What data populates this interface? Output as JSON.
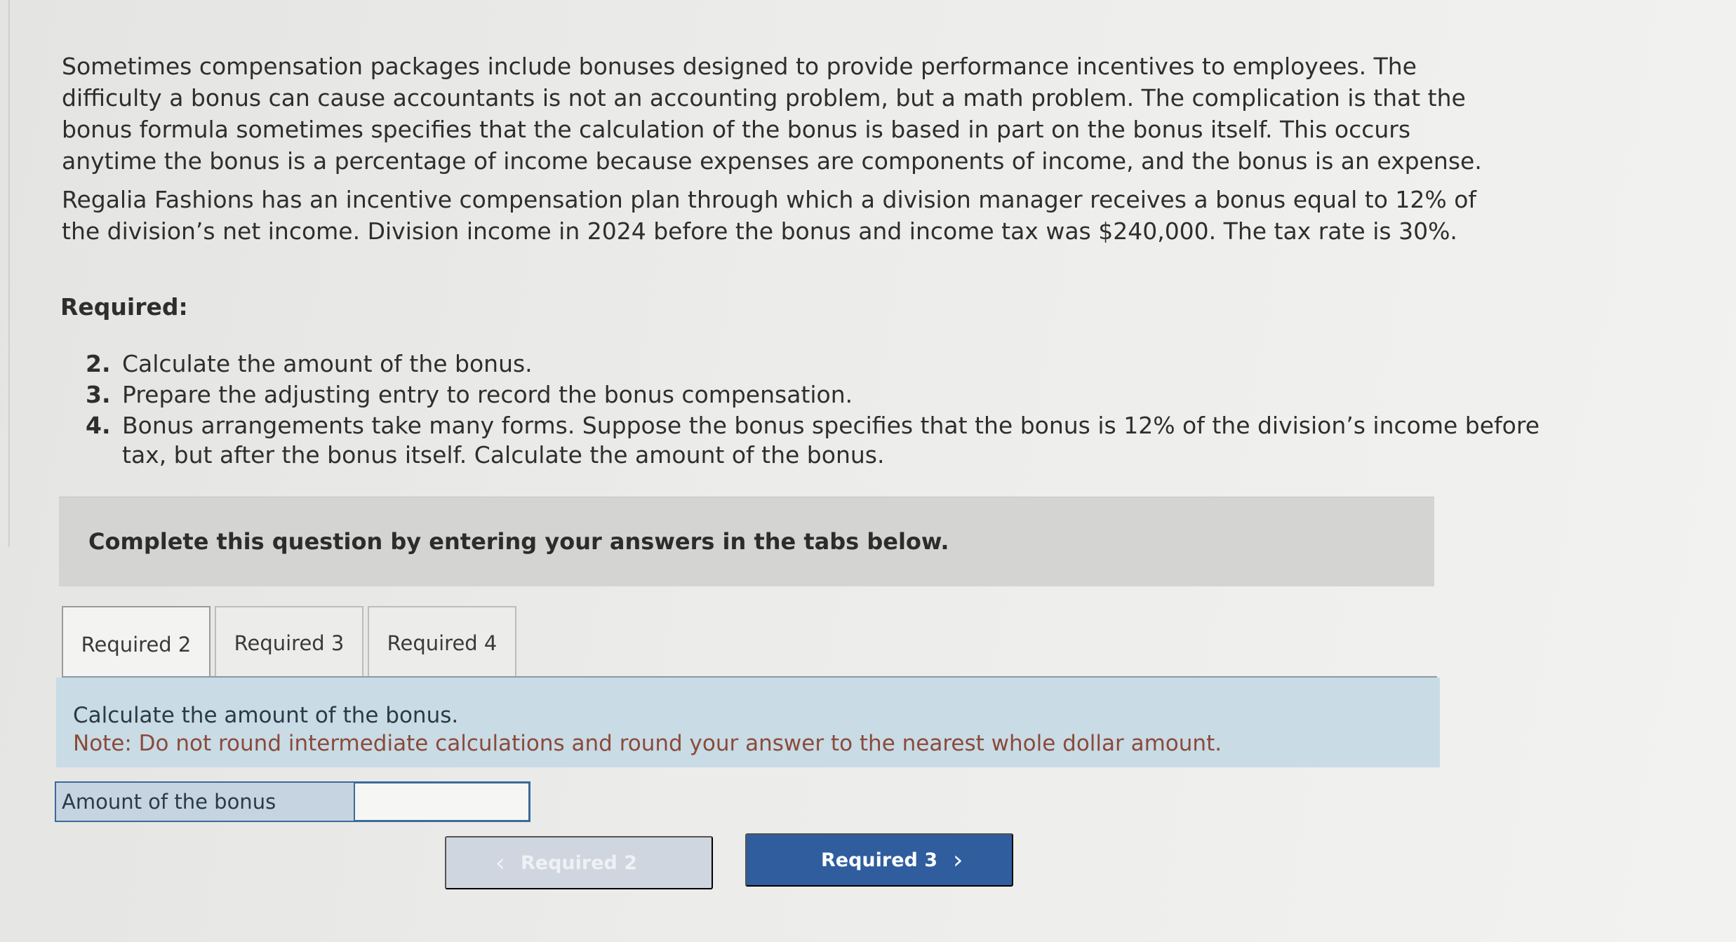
{
  "intro": {
    "paragraph1": "Sometimes compensation packages include bonuses designed to provide performance incentives to employees. The difficulty a bonus can cause accountants is not an accounting problem, but a math problem. The complication is that the bonus formula sometimes specifies that the calculation of the bonus is based in part on the bonus itself. This occurs anytime the bonus is a percentage of income because expenses are components of income, and the bonus is an expense.",
    "paragraph2": "Regalia Fashions has an incentive compensation plan through which a division manager receives a bonus equal to 12% of the division’s net income. Division income in 2024 before the bonus and income tax was $240,000. The tax rate is 30%."
  },
  "required": {
    "heading": "Required:",
    "items": [
      {
        "num": "2.",
        "text": "Calculate the amount of the bonus."
      },
      {
        "num": "3.",
        "text": "Prepare the adjusting entry to record the bonus compensation."
      },
      {
        "num": "4.",
        "text": "Bonus arrangements take many forms. Suppose the bonus specifies that the bonus is 12% of the division’s income before tax, but after the bonus itself. Calculate the amount of the bonus."
      }
    ]
  },
  "banner": {
    "text": "Complete this question by entering your answers in the tabs below."
  },
  "tabs": [
    {
      "label": "Required 2",
      "active": true
    },
    {
      "label": "Required 3",
      "active": false
    },
    {
      "label": "Required 4",
      "active": false
    }
  ],
  "panel": {
    "instruction": "Calculate the amount of the bonus.",
    "note": "Note: Do not round intermediate calculations and round your answer to the nearest whole dollar amount."
  },
  "answer": {
    "label": "Amount of the bonus",
    "value": ""
  },
  "navigation": {
    "prev_label": "Required 2",
    "next_label": "Required 3",
    "prev_icon": "chevron-left-icon",
    "next_icon": "chevron-right-icon"
  }
}
